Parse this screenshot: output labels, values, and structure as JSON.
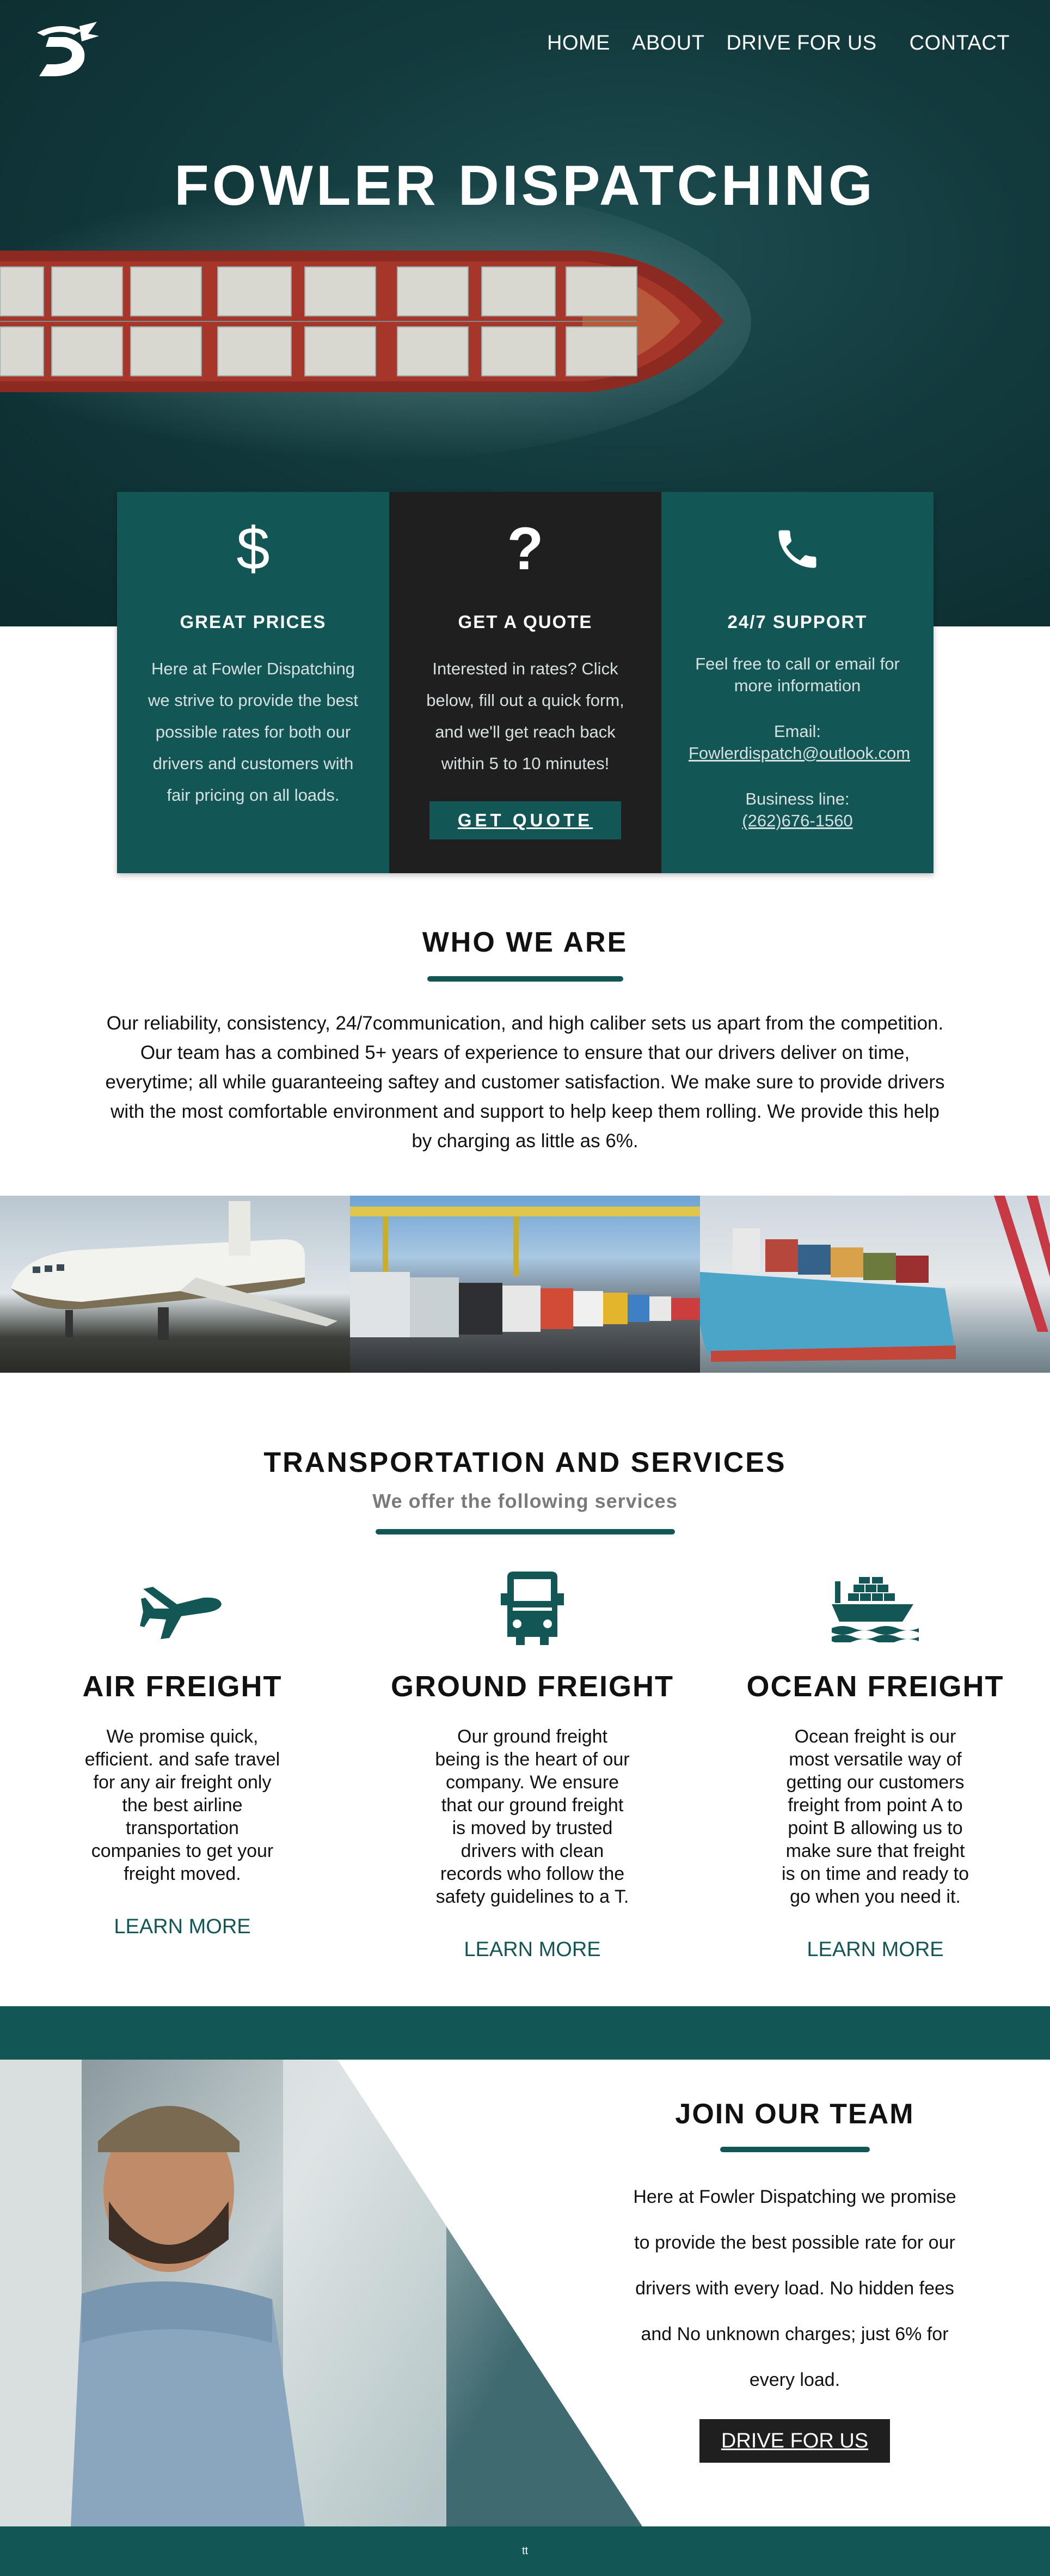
{
  "header": {
    "logo_icon": "fowler-d-logo",
    "nav": [
      "HOME",
      "ABOUT",
      "DRIVE FOR US",
      "CONTACT"
    ]
  },
  "hero": {
    "title": "FOWLER DISPATCHING"
  },
  "features": {
    "prices": {
      "icon": "dollar-icon",
      "title": "GREAT PRICES",
      "text": "Here at Fowler Dispatching we strive to provide the best possible rates for both our drivers and customers with fair pricing on all loads."
    },
    "quote": {
      "icon": "question-icon",
      "title": "GET A QUOTE",
      "text": "Interested in rates? Click below, fill out a quick form, and we'll get reach back within 5 to 10 minutes!",
      "button": "GET QUOTE"
    },
    "support": {
      "icon": "phone-icon",
      "title": "24/7 SUPPORT",
      "text": "Feel free to call or email for more information",
      "email_label": "Email:",
      "email": "Fowlerdispatch@outlook.com",
      "phone_label": "Business line:",
      "phone": "(262)676-1560"
    }
  },
  "who": {
    "title": "WHO WE ARE",
    "text": "Our reliability, consistency, 24/7communication, and high caliber sets us apart from the competition. Our team has a combined 5+ years of experience to ensure that our drivers deliver on time, everytime; all while guaranteeing saftey and customer satisfaction. We make sure to provide drivers with the most comfortable environment and support to help keep them rolling. We provide this help by charging as little as 6%."
  },
  "services": {
    "title": "TRANSPORTATION AND SERVICES",
    "subtitle": "We offer the following services",
    "items": [
      {
        "icon": "airplane-icon",
        "title": "AIR FREIGHT",
        "text": "We promise quick, efficient. and safe travel for any air freight only the best airline transportation companies to get your freight moved.",
        "link": "LEARN MORE"
      },
      {
        "icon": "truck-icon",
        "title": "GROUND FREIGHT",
        "text": "Our ground freight being is the heart of our company. We ensure that our ground freight is moved by trusted drivers with clean records who follow the safety guidelines to a T.",
        "link": "LEARN MORE"
      },
      {
        "icon": "ship-icon",
        "title": "OCEAN FREIGHT",
        "text": "Ocean freight is our most versatile way of getting our customers freight from point A to point B allowing us to make sure that freight is on time and ready to go when you need it.",
        "link": "LEARN MORE"
      }
    ]
  },
  "join": {
    "title": "JOIN OUR TEAM",
    "text": "Here at Fowler Dispatching we promise to provide the best possible rate for our drivers with every load. No hidden fees and No unknown charges; just 6% for every load.",
    "button": "DRIVE FOR US"
  },
  "footer": {
    "text": "tt"
  },
  "colors": {
    "teal": "#135656",
    "dark": "#1f1f1f",
    "hero_bg": "#123a3d"
  }
}
